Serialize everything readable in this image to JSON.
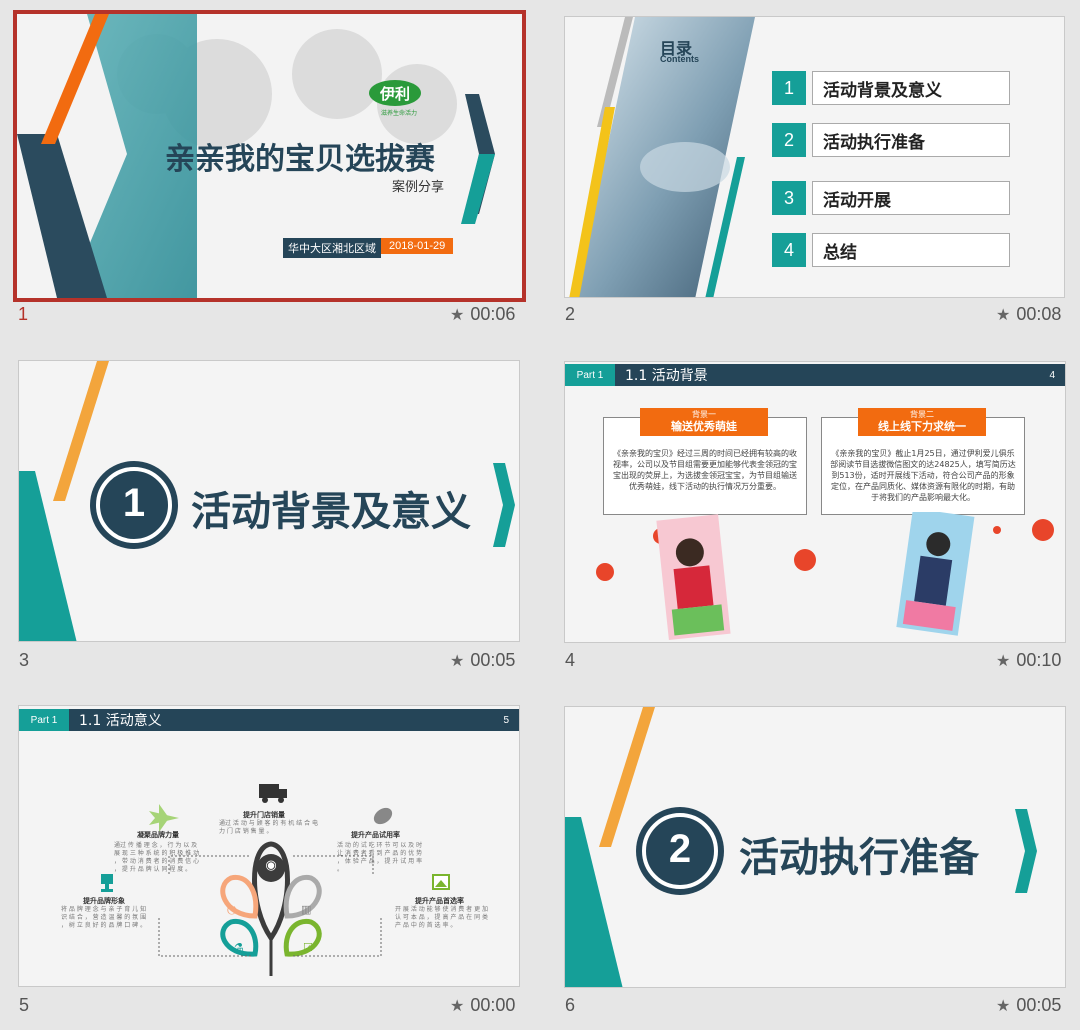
{
  "slides": [
    {
      "number": "1",
      "duration": "00:06",
      "title": "亲亲我的宝贝选拔赛",
      "subtitle": "案例分享",
      "region": "华中大区湘北区域",
      "date": "2018-01-29",
      "logo_text": "伊利",
      "logo_slogan": "滋养生命活力"
    },
    {
      "number": "2",
      "duration": "00:08",
      "toc_title": "目录",
      "toc_subtitle": "Contents",
      "items": [
        {
          "n": "1",
          "label": "活动背景及意义"
        },
        {
          "n": "2",
          "label": "活动执行准备"
        },
        {
          "n": "3",
          "label": "活动开展"
        },
        {
          "n": "4",
          "label": "总结"
        }
      ]
    },
    {
      "number": "3",
      "duration": "00:05",
      "section_num": "1",
      "section_title": "活动背景及意义"
    },
    {
      "number": "4",
      "duration": "00:10",
      "part": "Part 1",
      "heading": "1.1 活动背景",
      "page": "4",
      "cards": [
        {
          "kicker": "背景一",
          "title": "输送优秀萌娃",
          "body": "《亲亲我的宝贝》经过三周的时间已经拥有较高的收视率，公司以及节目组需要更加能够代表金领冠的宝宝出现的荧屏上，为选拔金领冠宝宝，为节目组输送优秀萌娃，线下活动的执行情况万分重要。"
        },
        {
          "kicker": "背景二",
          "title": "线上线下力求统一",
          "body": "《亲亲我的宝贝》截止1月25日，通过伊利爱儿俱乐部阅读节目选拔微信图文的达24825人，填写简历达到513份，适时开展线下活动，符合公司产品的形象定位，在产品同质化、媒体资源有限化的时期，有助于将我们的产品影响最大化。"
        }
      ]
    },
    {
      "number": "5",
      "duration": "00:00",
      "part": "Part 1",
      "heading": "1.1 活动意义",
      "page": "5",
      "points": [
        {
          "title": "提升门店销量",
          "text": "通过 活 动 与 顾 客 的 有 机 结 合 电 力 门 店 销 售 量 。"
        },
        {
          "title": "凝聚品牌力量",
          "text": "通过 传 播 理 念 ， 行 为 以 及 展 现 三 种 系 统 的 积 极 推 动 ， 带 动 消 费 者 的 消 费 信 心 ， 提 升 品 牌 认 同 程 度 。"
        },
        {
          "title": "提升产品试用率",
          "text": "活 动 的 试 吃 环 节 可 以 及 时 让 消 费 者 看 到 产 品 的 优 势 ， 体 验 产 品 ， 提 升 试 用 率 。"
        },
        {
          "title": "提升品牌形象",
          "text": "将 品 牌 理 念 与 亲 子 育 儿 知 识 结 合 ， 营 造 温 馨 的 氛 围 ， 树 立 良 好 的 品 牌 口 碑 。"
        },
        {
          "title": "提升产品首选率",
          "text": "开 展 活 动 能 够 使 消 费 者 更 加 认 可 本 品 ， 提 高 产 品 在 同 类 产 品 中 的 首 选 率 。"
        }
      ]
    },
    {
      "number": "6",
      "duration": "00:05",
      "section_num": "2",
      "section_title": "活动执行准备"
    }
  ],
  "colors": {
    "teal": "#159f98",
    "navy": "#254558",
    "orange": "#f26b10",
    "yellow": "#f3a53c",
    "selected": "#b5322a"
  },
  "icons": [
    "star-icon",
    "truck-icon",
    "plane-icon",
    "leaf-icon",
    "trophy-icon",
    "image-icon",
    "eye-icon",
    "power-icon",
    "trash-icon",
    "flask-icon",
    "check-icon",
    "chevron-right-icon"
  ]
}
